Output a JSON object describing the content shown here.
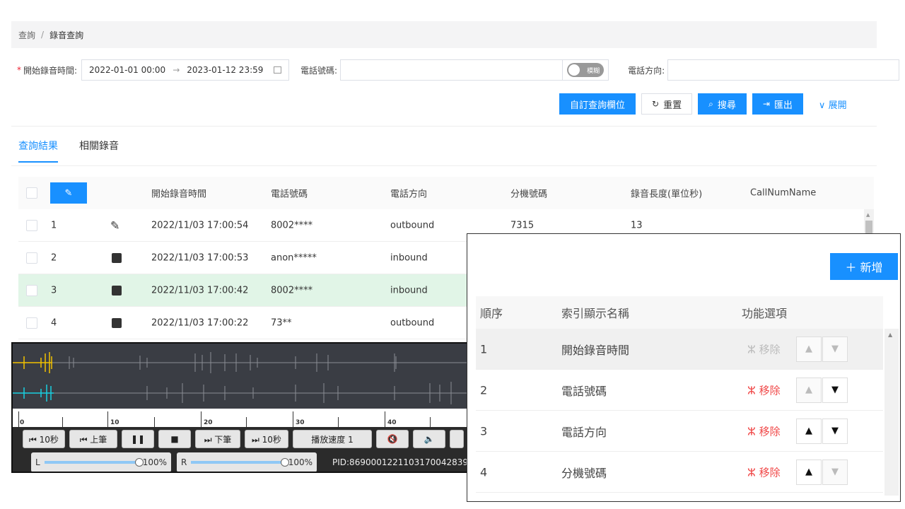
{
  "breadcrumb": {
    "root": "查詢",
    "sep": "/",
    "current": "錄音查詢"
  },
  "filters": {
    "required_mark": "*",
    "start_label": "開始錄音時間:",
    "start_value": "2022-01-01 00:00",
    "range_arrow": "→",
    "end_value": "2023-01-12 23:59",
    "phone_label": "電話號碼:",
    "toggle_label": "模糊",
    "direction_label": "電話方向:"
  },
  "actions": {
    "custom_fields": "自訂查詢欄位",
    "reset": "重置",
    "search": "搜尋",
    "export": "匯出",
    "expand": "展開"
  },
  "tabs": [
    "查詢結果",
    "相關錄音"
  ],
  "table": {
    "columns": [
      "開始錄音時間",
      "電話號碼",
      "電話方向",
      "分機號碼",
      "錄音長度(單位秒)",
      "CallNumName"
    ],
    "rows": [
      {
        "no": "1",
        "icon": "pencil-icon",
        "time": "2022/11/03 17:00:54",
        "phone": "8002****",
        "direction": "outbound",
        "ext": "7315",
        "length": "13"
      },
      {
        "no": "2",
        "icon": "book-icon",
        "time": "2022/11/03 17:00:53",
        "phone": "anon*****",
        "direction": "inbound",
        "ext": "",
        "length": ""
      },
      {
        "no": "3",
        "icon": "book-icon",
        "time": "2022/11/03 17:00:42",
        "phone": "8002****",
        "direction": "inbound",
        "ext": "",
        "length": ""
      },
      {
        "no": "4",
        "icon": "book-icon",
        "time": "2022/11/03 17:00:22",
        "phone": "73**",
        "direction": "outbound",
        "ext": "",
        "length": ""
      }
    ]
  },
  "player": {
    "ticks": [
      "0",
      "10",
      "20",
      "30",
      "40"
    ],
    "buttons": {
      "rew": "⏮ 10秒",
      "prev": "⏮ 上筆",
      "pause": "❚❚",
      "stop": "■",
      "next": "⏭ 下筆",
      "fwd": "⏭ 10秒",
      "speed": "播放速度 1"
    },
    "left_label": "L",
    "left_value": "100%",
    "right_label": "R",
    "right_value": "100%",
    "pid": "PID:869000122110317004283901"
  },
  "modal": {
    "add_button": "＋ 新增",
    "headers": [
      "順序",
      "索引顯示名稱",
      "功能選項"
    ],
    "remove_label": "移除",
    "rows": [
      {
        "order": "1",
        "name": "開始錄音時間"
      },
      {
        "order": "2",
        "name": "電話號碼"
      },
      {
        "order": "3",
        "name": "電話方向"
      },
      {
        "order": "4",
        "name": "分機號碼"
      }
    ]
  },
  "colors": {
    "primary": "#1890ff",
    "highlight_row": "#e1f5e7",
    "remove": "#f04848"
  }
}
